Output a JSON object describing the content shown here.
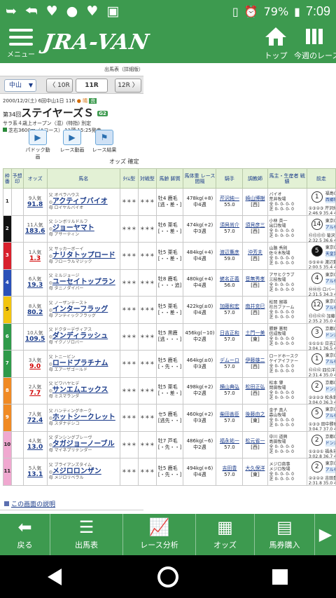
{
  "status_bar": {
    "battery": "79%",
    "time": "7:09"
  },
  "header": {
    "menu_label": "メニュー",
    "logo": "JRA-VAN",
    "top_label": "トップ",
    "week_label": "今週のレース"
  },
  "breadcrumb": "出馬表（詳細版）",
  "race_nav": {
    "course": "中山",
    "prev": "10R",
    "current": "11R",
    "next": "12R"
  },
  "race": {
    "date": "2000/12/2(土)",
    "meeting": "6回中山1日 11R",
    "weather": "● 晴",
    "going": "良",
    "edition": "第34回",
    "name": "ステイヤーズＳ",
    "grade": "G2",
    "conditions": "サラ系４歳上オープン（混）(特指) 別定",
    "course": "芝右3600m（Aコース） 11頭 15:25発走"
  },
  "media_buttons": {
    "paddock": "パドック動画",
    "race_movie": "レース動画",
    "race_result": "レース結果"
  },
  "odds_status": "オッズ 確定",
  "table": {
    "headers": {
      "waku": "枠番",
      "num": "予想印",
      "odds": "オッズ",
      "horse": "馬名",
      "pattern": "ﾀｲﾑ型",
      "match": "対戦型",
      "sex_age": "馬齢 脚質",
      "weight": "馬体重 レース間隔",
      "jockey": "騎手",
      "trainer": "調教師",
      "owner": "馬主・生産者 戦績",
      "prev": "前走"
    },
    "rows": [
      {
        "waku": "1",
        "waku_color": "#ffffff",
        "waku_text": "#222222",
        "pop": "9人気",
        "odds": "91.8",
        "hot": false,
        "sire": "父 オペラハウス",
        "horse": "アクティブバイオ",
        "dam_sire": "母 ロイヤルバイオ",
        "pattern": "＊＊＊",
        "match": "＊＊＊",
        "sex_age": "牡4 鹿毛",
        "style": "[逃・差・]",
        "weight": "478kg(+8)",
        "interval": "中4週",
        "jockey": "芹沢純一",
        "jweight": "55.0",
        "trainer": "崎山博樹",
        "tregion": "[西]",
        "owner": "バイオ",
        "breeder": "荒井牧場",
        "rec1": "全 0- 0- 0- 0",
        "rec2": "芝 0- 0- 0- 0",
        "prev_place": "1",
        "prev_black": false,
        "prev_track": "福島00/10",
        "prev_race": "西郷特別",
        "prev_jockey": "①③②③ 芹沢純一",
        "prev_time": "2:46.9 35.4 49"
      },
      {
        "waku": "2",
        "waku_color": "#111111",
        "waku_text": "#ffffff",
        "pop": "11人気",
        "odds": "183.6",
        "hot": false,
        "sire": "父 シンボリルドルフ",
        "horse": "ジョーヤマト",
        "dam_sire": "母 アサーティン",
        "pattern": "＊＊＊",
        "match": "＊＊＊",
        "sex_age": "牡6 栗毛",
        "style": "[・・差・]",
        "weight": "474kg(+2)",
        "interval": "中3週",
        "jockey": "須貝尚介",
        "jweight": "57.0",
        "trainer": "須貝彦三",
        "tregion": "[西]",
        "owner": "小林 英一",
        "breeder": "出口牧場",
        "rec1": "全 0- 0- 0- 0",
        "rec2": "芝 0- 0- 0- 0",
        "prev_place": "14",
        "prev_black": false,
        "prev_track": "東京00/11",
        "prev_race": "アルゼンチ",
        "prev_jockey": "⑫⑬⑬⑬ 菊沢隆徳",
        "prev_time": "2:32.5 36.6 47"
      },
      {
        "waku": "3",
        "waku_color": "#d8202c",
        "waku_text": "#ffffff",
        "pop": "1人気",
        "odds": "1.3",
        "hot": true,
        "sire": "父 サッカーボーイ",
        "horse": "ナリタトップロード",
        "dam_sire": "母 フローラルマジック",
        "pattern": "＊＊＊",
        "match": "＊＊＊",
        "sex_age": "牡5 栗毛",
        "style": "[・・差・]",
        "weight": "484kg(+4)",
        "interval": "中4週",
        "jockey": "渡辺薫彦",
        "jweight": "59.0",
        "trainer": "沖芳夫",
        "tregion": "[西]",
        "owner": "山路 秀則",
        "breeder": "佐々木牧場",
        "rec1": "全 0- 0- 0- 0",
        "rec2": "芝 0- 0- 0- 0",
        "prev_place": "5",
        "prev_black": true,
        "prev_track": "東京00/10",
        "prev_race": "天皇賞（秋",
        "prev_jockey": "⑤⑤④④ 渡辺薫彦",
        "prev_time": "2:00.5 35.4 48"
      },
      {
        "waku": "4",
        "waku_color": "#2a50b8",
        "waku_text": "#ffffff",
        "pop": "6人気",
        "odds": "19.3",
        "hot": false,
        "sire": "父 ミルジョージ",
        "horse": "ユーセイトップラン",
        "dam_sire": "母 タニノダイバー",
        "pattern": "＊＊＊",
        "match": "＊＊＊",
        "sex_age": "牡8 鹿毛",
        "style": "[・・・追]",
        "weight": "480kg(+4)",
        "interval": "中4週",
        "jockey": "蛯名正義",
        "jweight": "56.0",
        "trainer": "音無秀孝",
        "tregion": "[西]",
        "owner": "アサヒクラブ",
        "breeder": "三枝牧場",
        "rec1": "全 0- 0- 0- 0",
        "rec2": "芝 0- 0- 0- 0",
        "prev_place": "4",
        "prev_black": false,
        "prev_track": "東京00/11",
        "prev_race": "アルゼンチ",
        "prev_jockey": "⑭⑭⑮ ロバーツ",
        "prev_time": "2:31.5 34.3 47"
      },
      {
        "waku": "5",
        "waku_color": "#f2c40f",
        "waku_text": "#222222",
        "pop": "8人気",
        "odds": "80.2",
        "hot": false,
        "sire": "父 ノーザンテースト",
        "horse": "インターフラッグ",
        "dam_sire": "母 アンティックフラッグ",
        "pattern": "＊＊＊",
        "match": "＊＊＊",
        "sex_age": "牡5 栗毛",
        "style": "[・・差・]",
        "weight": "422kg(±0)",
        "interval": "中4週",
        "jockey": "加藤和宏",
        "jweight": "57.0",
        "trainer": "南井克巳",
        "tregion": "[西]",
        "owner": "松岡 留雄",
        "breeder": "社台ファーム",
        "rec1": "全 0- 0- 0- 0",
        "rec2": "芝 0- 0- 0- 0",
        "prev_place": "12",
        "prev_black": false,
        "prev_track": "東京00/11",
        "prev_race": "アルゼンチ",
        "prev_jockey": "⑬⑬⑫⑫ 加藤和宏",
        "prev_time": "2:35.2 35.0 47"
      },
      {
        "waku": "6",
        "waku_color": "#2f9a4a",
        "waku_text": "#ffffff",
        "pop": "10人気",
        "odds": "109.5",
        "hot": false,
        "sire": "父 ドクターデヴィアス",
        "horse": "ダンディラッシュ",
        "dam_sire": "母 イクノゾロバー",
        "pattern": "＊＊＊",
        "match": "＊＊＊",
        "sex_age": "牡5 黒鹿",
        "style": "[逃・・・]",
        "weight": "456kg(−10)",
        "interval": "中2週",
        "jockey": "日吉正和",
        "jweight": "57.0",
        "trainer": "土門一美",
        "tregion": "[東]",
        "owner": "勝野 憲明",
        "breeder": "信成牧場",
        "rec1": "全 0- 0- 0- 0",
        "rec2": "芝 0- 0- 0- 0",
        "prev_place": "3",
        "prev_black": false,
        "prev_track": "京都00/11",
        "prev_race": "ドンカスタ",
        "prev_jockey": "①①①① 日吉正和",
        "prev_time": "3:04.1 36.5 48"
      },
      {
        "waku": "7",
        "waku_color": "#2f9a4a",
        "waku_text": "#ffffff",
        "pop": "3人気",
        "odds": "9.0",
        "hot": true,
        "sire": "父 トニービン",
        "horse": "ロードプラチナム",
        "dam_sire": "母 エアーザゴールド",
        "pattern": "＊＊＊",
        "match": "＊＊＊",
        "sex_age": "牡5 鹿毛",
        "style": "[・先・・]",
        "weight": "464kg(±0)",
        "interval": "中3週",
        "jockey": "デムーロ",
        "jweight": "57.0",
        "trainer": "伊藤雄二",
        "tregion": "[西]",
        "owner": "ロードホースク",
        "breeder": "ケイアイファー",
        "rec1": "全 0- 0- 0- 0",
        "rec2": "芝 0- 0- 0- 0",
        "prev_place": "1",
        "prev_black": false,
        "prev_track": "東京00/11",
        "prev_race": "アルゼンチ",
        "prev_jockey": "⑫⑫⑫ 四位洋文",
        "prev_time": "2:31.4 35.0 47"
      },
      {
        "waku": "8",
        "waku_color": "#f08a24",
        "waku_text": "#ffffff",
        "pop": "2人気",
        "odds": "7.7",
        "hot": true,
        "sire": "父 ビワハヤヒデ",
        "horse": "サンエムエックス",
        "dam_sire": "母 ミスマランダ",
        "pattern": "＊＊＊",
        "match": "＊＊＊",
        "sex_age": "牡5 栗毛",
        "style": "[・・差・]",
        "weight": "498kg(+2)",
        "interval": "中2週",
        "jockey": "横山典弘",
        "jweight": "57.0",
        "trainer": "松田正弘",
        "tregion": "[西]",
        "owner": "松本 肇",
        "breeder": "岡田牧場",
        "rec1": "全 0- 0- 0- 0",
        "rec2": "芝 0- 0- 0- 0",
        "prev_place": "2",
        "prev_black": false,
        "prev_track": "京都00/11",
        "prev_race": "ドンカスタ",
        "prev_jockey": "②②②③ 松永幹夫",
        "prev_time": "3:04.0 36.3 48"
      },
      {
        "waku": "9",
        "waku_color": "#f08a24",
        "waku_text": "#ffffff",
        "pop": "7人気",
        "odds": "72.4",
        "hot": false,
        "sire": "父 ハンティングホーク",
        "horse": "ホットシークレット",
        "dam_sire": "母 スダナデシコ",
        "pattern": "＊＊＊",
        "match": "＊＊＊",
        "sex_age": "セ5 鹿毛",
        "style": "[逃先・・]",
        "weight": "460kg(+2)",
        "interval": "中3週",
        "jockey": "柴田善臣",
        "jweight": "57.0",
        "trainer": "後藤由之",
        "tregion": "[東]",
        "owner": "金子 真人",
        "breeder": "森山牧場",
        "rec1": "全 0- 0- 0- 0",
        "rec2": "芝 0- 0- 0- 0",
        "prev_place": "5",
        "prev_black": false,
        "prev_track": "東京00/11",
        "prev_race": "アルゼンチ",
        "prev_jockey": "①③③ 田中勝春",
        "prev_time": "3:04.7 37.0 48"
      },
      {
        "waku": "10",
        "waku_color": "#f0a8d0",
        "waku_text": "#222222",
        "pop": "4人気",
        "odds": "13.0",
        "hot": false,
        "sire": "父 ダンシングブレーヴ",
        "horse": "タガジョーノーブル",
        "dam_sire": "母 マイネプリテンダー",
        "pattern": "＊＊＊",
        "match": "＊＊＊",
        "sex_age": "牡7 芦毛",
        "style": "[・先・・]",
        "weight": "486kg(−6)",
        "interval": "中2週",
        "jockey": "福永祐一",
        "jweight": "57.0",
        "trainer": "松元省一",
        "tregion": "[西]",
        "owner": "中川 道興",
        "breeder": "島田牧場",
        "rec1": "全 0- 0- 0- 0",
        "rec2": "芝 0- 0- 0- 0",
        "prev_place": "2",
        "prev_black": false,
        "prev_track": "京都00/11",
        "prev_race": "ドンカスタ",
        "prev_jockey": "①②②① 福永祐一",
        "prev_time": "3:02.8 36.7 47"
      },
      {
        "waku": "11",
        "waku_color": "#f0a8d0",
        "waku_text": "#222222",
        "pop": "5人気",
        "odds": "13.1",
        "hot": false,
        "sire": "父 ブライアンズタイム",
        "horse": "メジロロンザン",
        "dam_sire": "母 メジロリベラル",
        "pattern": "＊＊＊",
        "match": "＊＊＊",
        "sex_age": "牡5 鹿毛",
        "style": "[・先・・]",
        "weight": "494kg(+6)",
        "interval": "中4週",
        "jockey": "吉田豊",
        "jweight": "57.0",
        "trainer": "大久保洋",
        "tregion": "[東]",
        "owner": "メジロ商事",
        "breeder": "メジロ牧場",
        "rec1": "全 0- 0- 0- 0",
        "rec2": "芝 0- 0- 0- 0",
        "prev_place": "2",
        "prev_black": false,
        "prev_track": "東京00/11",
        "prev_race": "アルゼンチ",
        "prev_jockey": "②②②② 吉田豊",
        "prev_time": "2:31.8 35.0 48"
      }
    ]
  },
  "help_link": "この画面の説明",
  "bottom_bar": {
    "back": "戻る",
    "card": "出馬表",
    "analysis": "レース分析",
    "odds": "オッズ",
    "betting": "馬券購入"
  }
}
